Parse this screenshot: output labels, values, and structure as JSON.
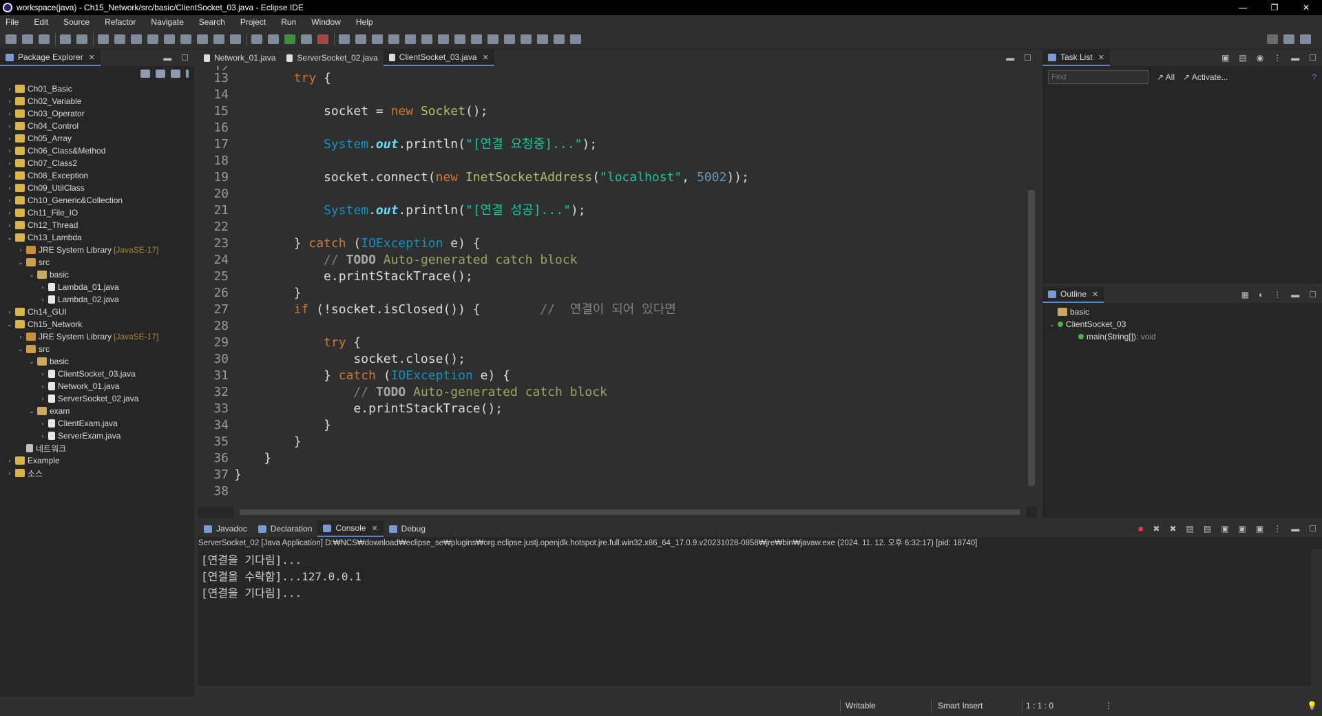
{
  "window": {
    "title": "workspace(java) - Ch15_Network/src/basic/ClientSocket_03.java - Eclipse IDE",
    "controls": [
      "—",
      "❐",
      "✕"
    ]
  },
  "menu": [
    "File",
    "Edit",
    "Source",
    "Refactor",
    "Navigate",
    "Search",
    "Project",
    "Run",
    "Window",
    "Help"
  ],
  "package_explorer": {
    "tab": "Package Explorer",
    "tree": [
      {
        "label": "Ch01_Basic",
        "depth": 0,
        "icon": "project-icon",
        "expanded": false
      },
      {
        "label": "Ch02_Variable",
        "depth": 0,
        "icon": "project-icon",
        "expanded": false
      },
      {
        "label": "Ch03_Operator",
        "depth": 0,
        "icon": "project-icon",
        "expanded": false
      },
      {
        "label": "Ch04_Control",
        "depth": 0,
        "icon": "project-icon",
        "expanded": false
      },
      {
        "label": "Ch05_Array",
        "depth": 0,
        "icon": "project-icon",
        "expanded": false
      },
      {
        "label": "Ch06_Class&Method",
        "depth": 0,
        "icon": "project-icon",
        "expanded": false
      },
      {
        "label": "Ch07_Class2",
        "depth": 0,
        "icon": "project-icon",
        "expanded": false
      },
      {
        "label": "Ch08_Exception",
        "depth": 0,
        "icon": "project-icon",
        "expanded": false
      },
      {
        "label": "Ch09_UtilClass",
        "depth": 0,
        "icon": "project-icon",
        "expanded": false
      },
      {
        "label": "Ch10_Generic&Collection",
        "depth": 0,
        "icon": "project-icon",
        "expanded": false
      },
      {
        "label": "Ch11_File_IO",
        "depth": 0,
        "icon": "project-icon",
        "expanded": false
      },
      {
        "label": "Ch12_Thread",
        "depth": 0,
        "icon": "project-icon",
        "expanded": false
      },
      {
        "label": "Ch13_Lambda",
        "depth": 0,
        "icon": "project-icon",
        "expanded": true
      },
      {
        "label": "JRE System Library",
        "suffix": "[JavaSE-17]",
        "depth": 1,
        "icon": "library-icon",
        "expanded": false
      },
      {
        "label": "src",
        "depth": 1,
        "icon": "source-folder-icon",
        "expanded": true
      },
      {
        "label": "basic",
        "depth": 2,
        "icon": "package-icon",
        "expanded": true
      },
      {
        "label": "Lambda_01.java",
        "depth": 3,
        "icon": "java-file-icon",
        "expanded": false
      },
      {
        "label": "Lambda_02.java",
        "depth": 3,
        "icon": "java-file-icon",
        "expanded": false
      },
      {
        "label": "Ch14_GUI",
        "depth": 0,
        "icon": "project-icon",
        "expanded": false
      },
      {
        "label": "Ch15_Network",
        "depth": 0,
        "icon": "project-icon",
        "expanded": true
      },
      {
        "label": "JRE System Library",
        "suffix": "[JavaSE-17]",
        "depth": 1,
        "icon": "library-icon",
        "expanded": false
      },
      {
        "label": "src",
        "depth": 1,
        "icon": "source-folder-icon",
        "expanded": true
      },
      {
        "label": "basic",
        "depth": 2,
        "icon": "package-icon",
        "expanded": true
      },
      {
        "label": "ClientSocket_03.java",
        "depth": 3,
        "icon": "java-file-icon",
        "expanded": false
      },
      {
        "label": "Network_01.java",
        "depth": 3,
        "icon": "java-file-icon",
        "expanded": false
      },
      {
        "label": "ServerSocket_02.java",
        "depth": 3,
        "icon": "java-file-icon",
        "expanded": false
      },
      {
        "label": "exam",
        "depth": 2,
        "icon": "package-icon",
        "expanded": true
      },
      {
        "label": "ClientExam.java",
        "depth": 3,
        "icon": "java-file-icon",
        "expanded": false
      },
      {
        "label": "ServerExam.java",
        "depth": 3,
        "icon": "java-file-icon",
        "expanded": false
      },
      {
        "label": "네트워크",
        "depth": 1,
        "icon": "text-file-icon",
        "leaf": true
      },
      {
        "label": "Example",
        "depth": 0,
        "icon": "project-icon",
        "expanded": false
      },
      {
        "label": "소스",
        "depth": 0,
        "icon": "project-icon",
        "expanded": false
      }
    ]
  },
  "editor": {
    "tabs": [
      {
        "label": "Network_01.java",
        "active": false
      },
      {
        "label": "ServerSocket_02.java",
        "active": false
      },
      {
        "label": "ClientSocket_03.java",
        "active": true
      }
    ],
    "partial_top_line": "12",
    "lines": [
      {
        "n": "13",
        "tokens": [
          [
            "        ",
            ""
          ],
          [
            "try",
            "kw"
          ],
          [
            " {",
            ""
          ]
        ]
      },
      {
        "n": "14",
        "tokens": []
      },
      {
        "n": "15",
        "tokens": [
          [
            "            socket = ",
            ""
          ],
          [
            "new",
            "kw"
          ],
          [
            " ",
            ""
          ],
          [
            "Socket",
            "cls"
          ],
          [
            "();",
            ""
          ]
        ]
      },
      {
        "n": "16",
        "tokens": []
      },
      {
        "n": "17",
        "tokens": [
          [
            "            ",
            ""
          ],
          [
            "System",
            "ty"
          ],
          [
            ".",
            ""
          ],
          [
            "out",
            "fld"
          ],
          [
            ".println(",
            ""
          ],
          [
            "\"[연결 요청중]...\"",
            "str"
          ],
          [
            ");",
            ""
          ]
        ]
      },
      {
        "n": "18",
        "tokens": []
      },
      {
        "n": "19",
        "tokens": [
          [
            "            socket.connect(",
            ""
          ],
          [
            "new",
            "kw"
          ],
          [
            " ",
            ""
          ],
          [
            "InetSocketAddress",
            "cls"
          ],
          [
            "(",
            ""
          ],
          [
            "\"localhost\"",
            "str"
          ],
          [
            ", ",
            ""
          ],
          [
            "5002",
            "num"
          ],
          [
            "));",
            ""
          ]
        ]
      },
      {
        "n": "20",
        "tokens": []
      },
      {
        "n": "21",
        "tokens": [
          [
            "            ",
            ""
          ],
          [
            "System",
            "ty"
          ],
          [
            ".",
            ""
          ],
          [
            "out",
            "fld"
          ],
          [
            ".println(",
            ""
          ],
          [
            "\"[연결 성공]...\"",
            "str"
          ],
          [
            ");",
            ""
          ]
        ]
      },
      {
        "n": "22",
        "tokens": []
      },
      {
        "n": "23",
        "tokens": [
          [
            "        } ",
            ""
          ],
          [
            "catch",
            "kw"
          ],
          [
            " (",
            ""
          ],
          [
            "IOException",
            "ty"
          ],
          [
            " e) {",
            ""
          ]
        ]
      },
      {
        "n": "24",
        "tokens": [
          [
            "            ",
            ""
          ],
          [
            "// ",
            "cm"
          ],
          [
            "TODO",
            "todo"
          ],
          [
            " Auto-generated catch block",
            "cmt"
          ]
        ]
      },
      {
        "n": "25",
        "tokens": [
          [
            "            e.printStackTrace();",
            ""
          ]
        ]
      },
      {
        "n": "26",
        "tokens": [
          [
            "        }",
            ""
          ]
        ]
      },
      {
        "n": "27",
        "tokens": [
          [
            "        ",
            ""
          ],
          [
            "if",
            "kw"
          ],
          [
            " (!socket.isClosed()) {        ",
            ""
          ],
          [
            "//  연결이 되어 있다면",
            "cm"
          ]
        ]
      },
      {
        "n": "28",
        "tokens": []
      },
      {
        "n": "29",
        "tokens": [
          [
            "            ",
            ""
          ],
          [
            "try",
            "kw"
          ],
          [
            " {",
            ""
          ]
        ]
      },
      {
        "n": "30",
        "tokens": [
          [
            "                socket.close();",
            ""
          ]
        ]
      },
      {
        "n": "31",
        "tokens": [
          [
            "            } ",
            ""
          ],
          [
            "catch",
            "kw"
          ],
          [
            " (",
            ""
          ],
          [
            "IOException",
            "ty"
          ],
          [
            " e) {",
            ""
          ]
        ]
      },
      {
        "n": "32",
        "tokens": [
          [
            "                ",
            ""
          ],
          [
            "// ",
            "cm"
          ],
          [
            "TODO",
            "todo"
          ],
          [
            " Auto-generated catch block",
            "cmt"
          ]
        ]
      },
      {
        "n": "33",
        "tokens": [
          [
            "                e.printStackTrace();",
            ""
          ]
        ]
      },
      {
        "n": "34",
        "tokens": [
          [
            "            }",
            ""
          ]
        ]
      },
      {
        "n": "35",
        "tokens": [
          [
            "        }",
            ""
          ]
        ]
      },
      {
        "n": "36",
        "tokens": [
          [
            "    }",
            ""
          ]
        ]
      },
      {
        "n": "37",
        "tokens": [
          [
            "}",
            ""
          ]
        ]
      },
      {
        "n": "38",
        "tokens": []
      }
    ]
  },
  "task_list": {
    "tab": "Task List",
    "find_placeholder": "Find",
    "all_label": "All",
    "activate_label": "Activate..."
  },
  "outline": {
    "tab": "Outline",
    "items": [
      {
        "label": "basic",
        "depth": 0,
        "icon": "package-icon"
      },
      {
        "label": "ClientSocket_03",
        "depth": 0,
        "icon": "class-icon",
        "expanded": true
      },
      {
        "label": "main(String[])",
        "suffix": " : void",
        "depth": 1,
        "icon": "method-icon"
      }
    ]
  },
  "console": {
    "tabs": [
      {
        "label": "Javadoc",
        "active": false
      },
      {
        "label": "Declaration",
        "active": false
      },
      {
        "label": "Console",
        "active": true
      },
      {
        "label": "Debug",
        "active": false
      }
    ],
    "description": "ServerSocket_02 [Java Application] D:₩NCS₩download₩eclipse_se₩plugins₩org.eclipse.justj.openjdk.hotspot.jre.full.win32.x86_64_17.0.9.v20231028-0858₩jre₩bin₩javaw.exe  (2024. 11. 12. 오후 6:32:17) [pid: 18740]",
    "output": [
      "[연결을 기다림]...",
      "[연결을 수락함]...127.0.0.1",
      "[연결을 기다림]..."
    ]
  },
  "status": {
    "writable": "Writable",
    "insert_mode": "Smart Insert",
    "position": "1 : 1 : 0"
  },
  "colors": {
    "keyword": "#cc7832",
    "type": "#1290c3",
    "string": "#17c6a3",
    "number": "#6897bb",
    "comment": "#808080",
    "active_tab_accent": "#5a86c6"
  }
}
